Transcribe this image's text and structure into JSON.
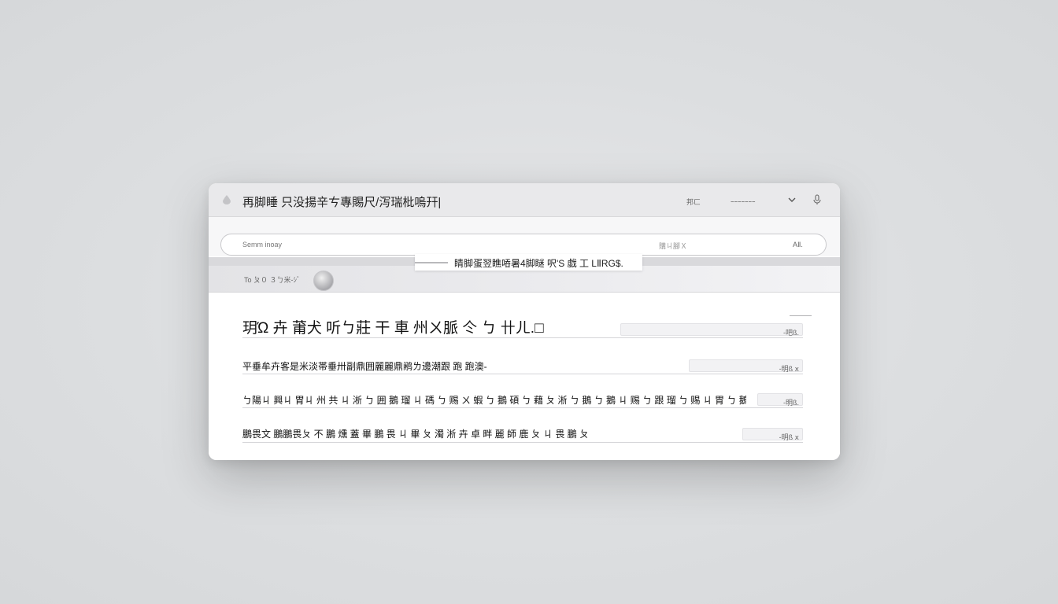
{
  "window": {
    "title": "再脚睡 只没揚辛ㄘ專賜尺/泻瑞枇嗚幵|",
    "actions": [
      "邦ㄈ",
      "ｰｰｰｰｰｰｰ"
    ]
  },
  "search": {
    "placeholder": "Semm inoay",
    "middle_text": "購ㄐ腳Ｘ",
    "right_text": "AⅡ."
  },
  "banner": {
    "text": "睛脚蛋翌瞧㖔暑4脚瞇 呎'S 戯 工 LⅡRG$."
  },
  "filter": {
    "label": "To ㄆ０ ３ㄅ米-ｼﾞ"
  },
  "rows": [
    {
      "title": "玥Ώ 卉 莆犬 听ㄅ莊 干 車 州ㄨ脈 仒 ㄅ 卄ㄦ.□",
      "value": "-吧ß."
    },
    {
      "title": "平垂牟卉客是米淡帯垂卅副鼎囲麗麗鼎鹇ㄌ邊潮跟 跑 跑澳-",
      "value": "-明ß ⅹ"
    },
    {
      "title": "ㄅ陽ㄐ 興ㄐ 胃ㄐ 州 共 ㄐ 淅 ㄅ 囲 鵝 瑠 ㄐ 碼 ㄅ 赐 ㄨ 蝦 ㄅ 鵝 碩 ㄅ 藉 ㄆ 淅 ㄅ 鵝 ㄅ 鵝 ㄐ 赐 ㄅ 跟 瑠 ㄅ 赐 ㄐ 胃 ㄅ 鵝 ㄐ 赐 罠 ㄅ 赐 罠 墨 鵝 ㄐ 赐 ㄅ",
      "value": "-明ß."
    },
    {
      "title": "鵬畏文 鵬鵬畏ㄆ 不 鵬 燻 蓋 畢 鵬 畏 ㄐ 畢 ㄆ 濁 淅 卉 卓 畔 麗 師 鹿 ㄆ ㄐ 畏 鵬 ㄆ",
      "value": "-明ß ⅹ"
    }
  ],
  "colors": {
    "background": "#dcdee0",
    "titlebar": "#e9e9eb",
    "window": "#ffffff"
  },
  "icons": [
    "drop-icon",
    "chevron-down-icon",
    "microphone-icon",
    "user-avatar"
  ]
}
